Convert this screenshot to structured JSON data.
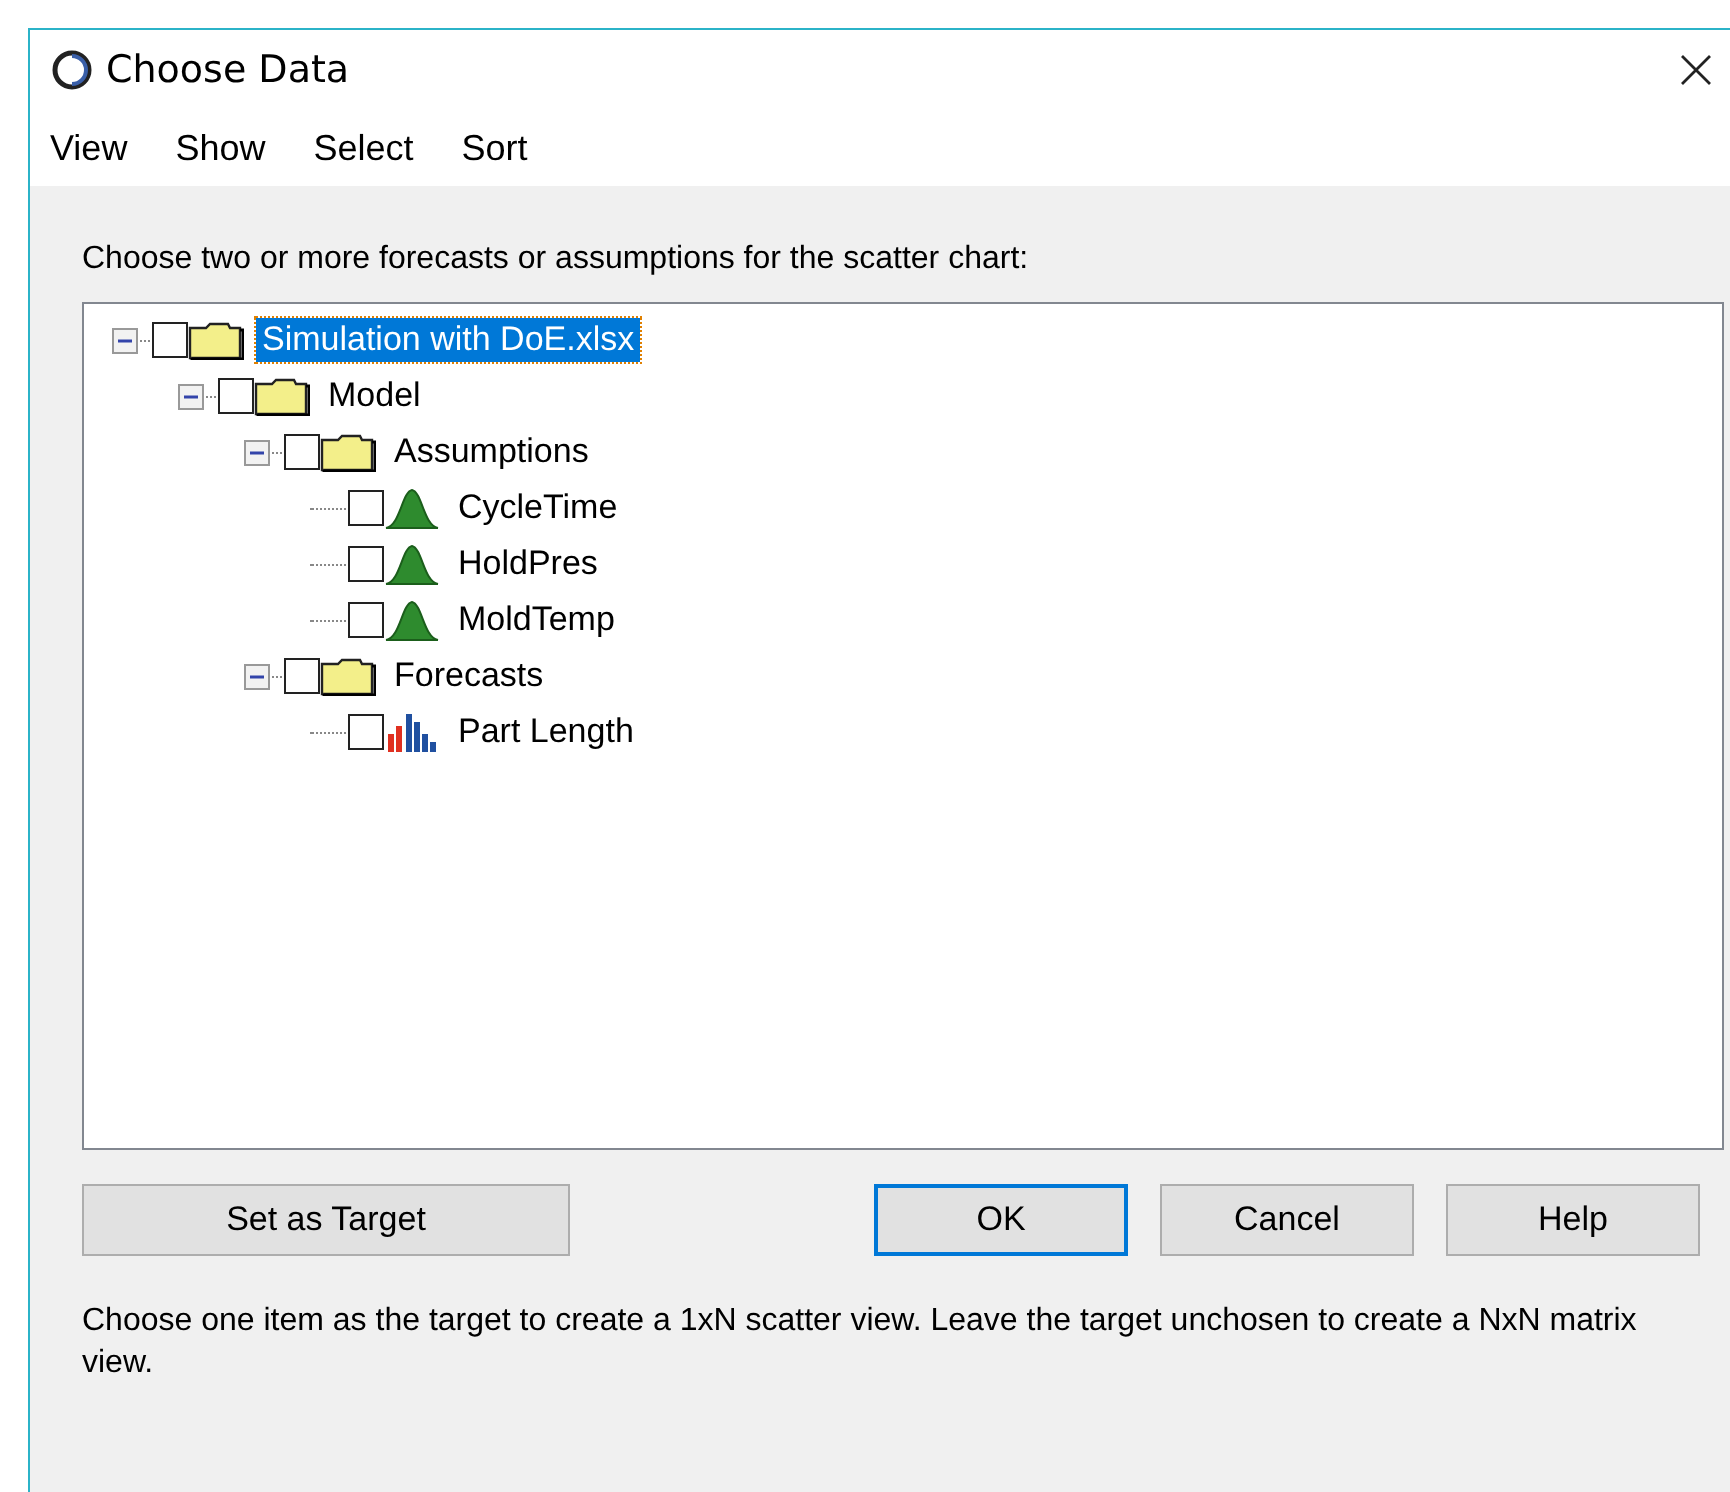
{
  "window": {
    "title": "Choose Data"
  },
  "menu": [
    {
      "label": "View"
    },
    {
      "label": "Show"
    },
    {
      "label": "Select"
    },
    {
      "label": "Sort"
    }
  ],
  "instruction": "Choose two or more forecasts or assumptions for the scatter chart:",
  "tree": [
    {
      "label": "Simulation with DoE.xlsx",
      "kind": "folder",
      "expanded": true,
      "checked": false,
      "selected": true,
      "children": [
        {
          "label": "Model",
          "kind": "folder",
          "expanded": true,
          "checked": false,
          "selected": false,
          "children": [
            {
              "label": "Assumptions",
              "kind": "folder",
              "expanded": true,
              "checked": false,
              "selected": false,
              "children": [
                {
                  "label": "CycleTime",
                  "kind": "assumption",
                  "checked": false,
                  "selected": false
                },
                {
                  "label": "HoldPres",
                  "kind": "assumption",
                  "checked": false,
                  "selected": false
                },
                {
                  "label": "MoldTemp",
                  "kind": "assumption",
                  "checked": false,
                  "selected": false
                }
              ]
            },
            {
              "label": "Forecasts",
              "kind": "folder",
              "expanded": true,
              "checked": false,
              "selected": false,
              "children": [
                {
                  "label": "Part Length",
                  "kind": "forecast",
                  "checked": false,
                  "selected": false
                }
              ]
            }
          ]
        }
      ]
    }
  ],
  "buttons": [
    {
      "label": "Set as Target",
      "default": false
    },
    {
      "label": "OK",
      "default": true
    },
    {
      "label": "Cancel",
      "default": false
    },
    {
      "label": "Help",
      "default": false
    }
  ],
  "note": "Choose one item as the target to create a 1xN scatter view.  Leave the target unchosen to create a NxN matrix view."
}
